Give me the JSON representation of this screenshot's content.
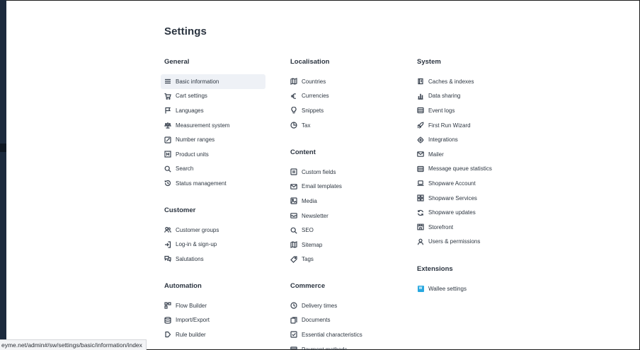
{
  "page": {
    "title": "Settings"
  },
  "status_bar": {
    "url": "eyme.net/admin#/sw/settings/basic/information/index"
  },
  "colors": {
    "active_item_bg": "#eef1f6",
    "text": "#2e3742",
    "heading": "#2b3440",
    "wallee_brand": "#28a8e0"
  },
  "sections": {
    "general": {
      "title": "General",
      "items": [
        {
          "label": "Basic information",
          "icon": "menu-icon"
        },
        {
          "label": "Cart settings",
          "icon": "cart-icon"
        },
        {
          "label": "Languages",
          "icon": "flag-icon"
        },
        {
          "label": "Measurement system",
          "icon": "scale-icon"
        },
        {
          "label": "Number ranges",
          "icon": "number-range-icon"
        },
        {
          "label": "Product units",
          "icon": "unit-icon"
        },
        {
          "label": "Search",
          "icon": "search-icon"
        },
        {
          "label": "Status management",
          "icon": "history-icon"
        }
      ]
    },
    "customer": {
      "title": "Customer",
      "items": [
        {
          "label": "Customer groups",
          "icon": "users-icon"
        },
        {
          "label": "Log-in & sign-up",
          "icon": "sign-in-icon"
        },
        {
          "label": "Salutations",
          "icon": "chat-icon"
        }
      ]
    },
    "automation": {
      "title": "Automation",
      "items": [
        {
          "label": "Flow Builder",
          "icon": "flow-icon"
        },
        {
          "label": "Import/Export",
          "icon": "database-icon"
        },
        {
          "label": "Rule builder",
          "icon": "rule-icon"
        }
      ]
    },
    "localisation": {
      "title": "Localisation",
      "items": [
        {
          "label": "Countries",
          "icon": "map-icon"
        },
        {
          "label": "Currencies",
          "icon": "euro-icon"
        },
        {
          "label": "Snippets",
          "icon": "bulb-icon"
        },
        {
          "label": "Tax",
          "icon": "pie-icon"
        }
      ]
    },
    "content": {
      "title": "Content",
      "items": [
        {
          "label": "Custom fields",
          "icon": "custom-field-icon"
        },
        {
          "label": "Email templates",
          "icon": "envelope-icon"
        },
        {
          "label": "Media",
          "icon": "image-icon"
        },
        {
          "label": "Newsletter",
          "icon": "newsletter-icon"
        },
        {
          "label": "SEO",
          "icon": "search-icon"
        },
        {
          "label": "Sitemap",
          "icon": "map-icon"
        },
        {
          "label": "Tags",
          "icon": "tag-icon"
        }
      ]
    },
    "commerce": {
      "title": "Commerce",
      "items": [
        {
          "label": "Delivery times",
          "icon": "clock-icon"
        },
        {
          "label": "Documents",
          "icon": "documents-icon"
        },
        {
          "label": "Essential characteristics",
          "icon": "checkbox-icon"
        },
        {
          "label": "Payment methods",
          "icon": "credit-card-icon"
        }
      ]
    },
    "system": {
      "title": "System",
      "items": [
        {
          "label": "Caches & indexes",
          "icon": "cache-icon"
        },
        {
          "label": "Data sharing",
          "icon": "bar-chart-icon"
        },
        {
          "label": "Event logs",
          "icon": "list-icon"
        },
        {
          "label": "First Run Wizard",
          "icon": "rocket-icon"
        },
        {
          "label": "Integrations",
          "icon": "target-icon"
        },
        {
          "label": "Mailer",
          "icon": "envelope-icon"
        },
        {
          "label": "Message queue statistics",
          "icon": "list-icon"
        },
        {
          "label": "Shopware Account",
          "icon": "laptop-icon"
        },
        {
          "label": "Shopware Services",
          "icon": "grid-icon"
        },
        {
          "label": "Shopware updates",
          "icon": "refresh-icon"
        },
        {
          "label": "Storefront",
          "icon": "storefront-icon"
        },
        {
          "label": "Users & permissions",
          "icon": "user-icon"
        }
      ]
    },
    "extensions": {
      "title": "Extensions",
      "items": [
        {
          "label": "Wallee settings",
          "icon": "wallee-logo"
        }
      ]
    }
  }
}
